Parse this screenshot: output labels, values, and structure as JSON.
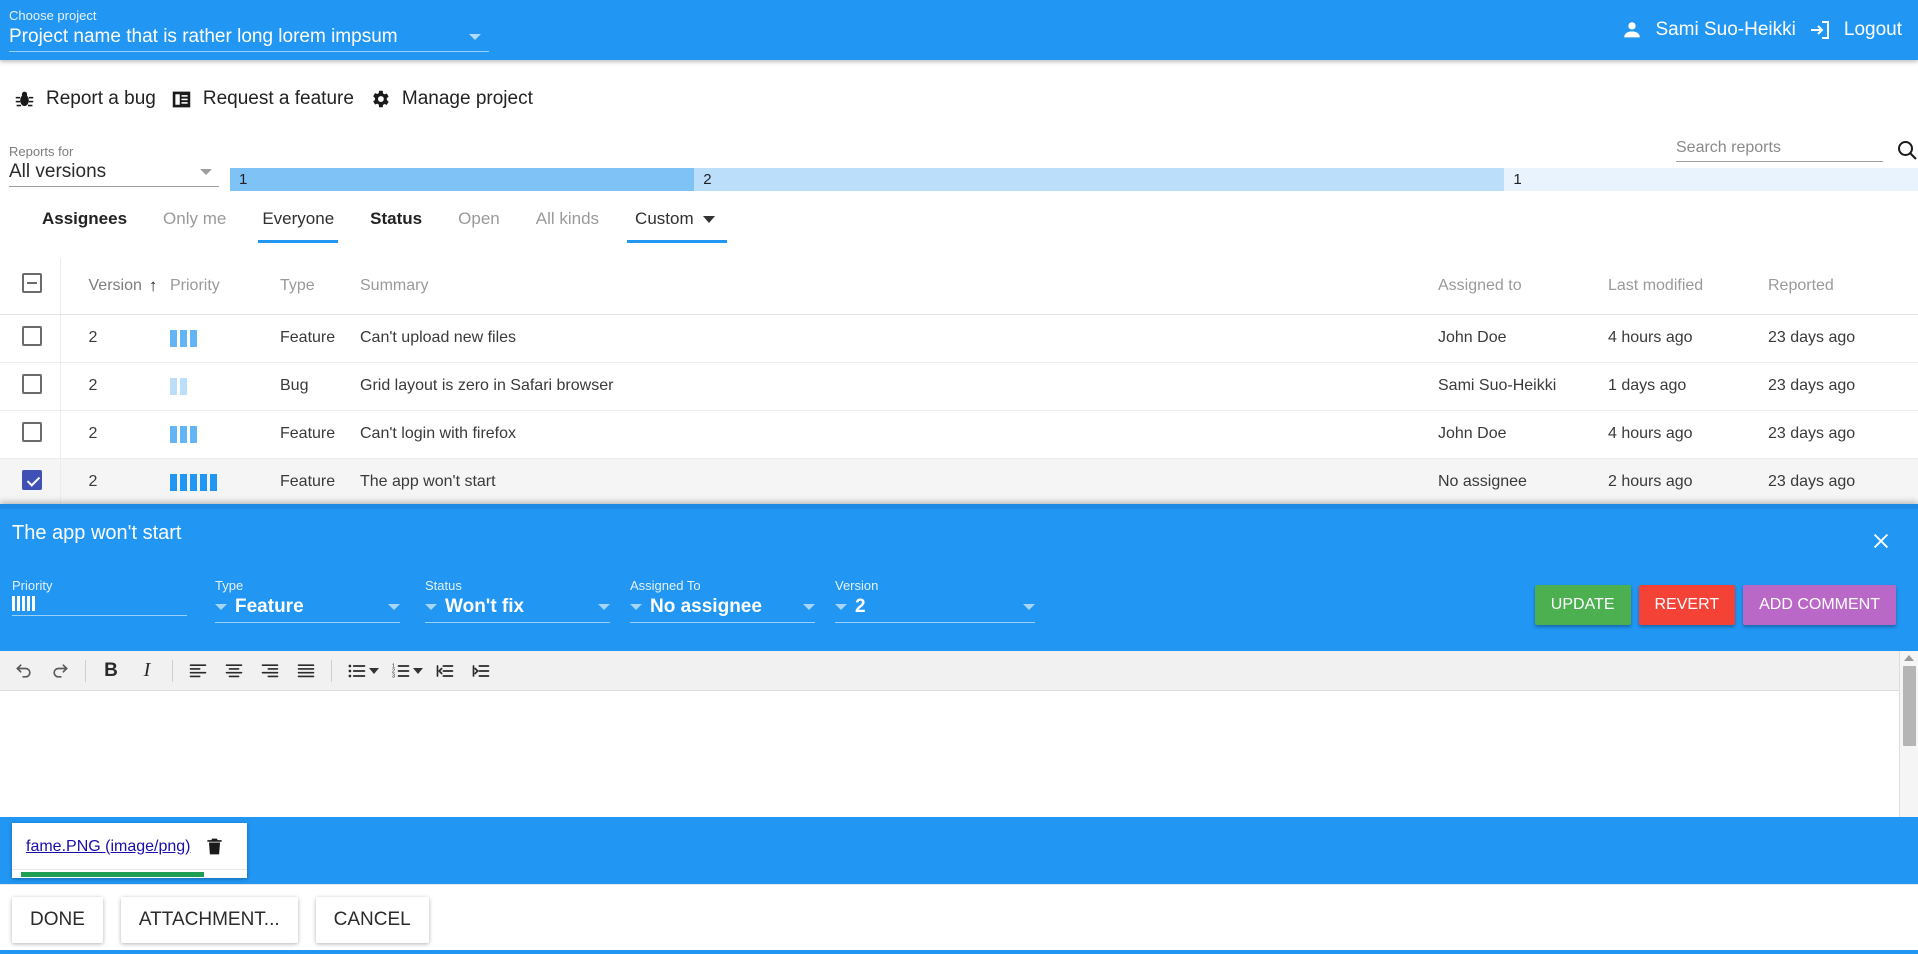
{
  "topbar": {
    "project_label": "Choose project",
    "project_value": "Project name that is rather long lorem impsum",
    "user_name": "Sami Suo-Heikki",
    "logout_label": "Logout"
  },
  "actions": [
    {
      "icon": "bug-icon",
      "label": "Report a bug"
    },
    {
      "icon": "feature-icon",
      "label": "Request a feature"
    },
    {
      "icon": "gear-icon",
      "label": "Manage project"
    }
  ],
  "search": {
    "placeholder": "Search reports",
    "value": "",
    "icon": "search-icon"
  },
  "version_filter": {
    "label": "Reports for",
    "value": "All versions",
    "segments": [
      {
        "label": "1",
        "width_pct": 27.5,
        "color": "#7fc2f5"
      },
      {
        "label": "2",
        "width_pct": 48.0,
        "color": "#bbdefb"
      },
      {
        "label": "1",
        "width_pct": 24.5,
        "color": "#e8f3fd"
      }
    ]
  },
  "tabs": [
    {
      "name": "assignees-group",
      "label": "Assignees",
      "state": "group"
    },
    {
      "name": "only-me",
      "label": "Only me",
      "state": "inactive"
    },
    {
      "name": "everyone",
      "label": "Everyone",
      "state": "active"
    },
    {
      "name": "status-group",
      "label": "Status",
      "state": "group"
    },
    {
      "name": "open",
      "label": "Open",
      "state": "inactive"
    },
    {
      "name": "all-kinds",
      "label": "All kinds",
      "state": "inactive"
    },
    {
      "name": "custom",
      "label": "Custom",
      "state": "custom"
    }
  ],
  "table": {
    "select_all_state": "indeterminate",
    "columns": [
      "Version",
      "Priority",
      "Type",
      "Summary",
      "Assigned to",
      "Last modified",
      "Reported"
    ],
    "sort_column": "Version",
    "sort_direction": "asc",
    "rows": [
      {
        "checked": false,
        "version": "2",
        "priority": 3,
        "priority_color": "#64b5f6",
        "type": "Feature",
        "summary": "Can't upload new files",
        "assigned_to": "John Doe",
        "last_modified": "4 hours ago",
        "reported": "23 days ago"
      },
      {
        "checked": false,
        "version": "2",
        "priority": 2,
        "priority_color": "#bbdefb",
        "type": "Bug",
        "summary": "Grid layout is zero in Safari browser",
        "assigned_to": "Sami Suo-Heikki",
        "last_modified": "1 days ago",
        "reported": "23 days ago"
      },
      {
        "checked": false,
        "version": "2",
        "priority": 3,
        "priority_color": "#64b5f6",
        "type": "Feature",
        "summary": "Can't login with firefox",
        "assigned_to": "John Doe",
        "last_modified": "4 hours ago",
        "reported": "23 days ago"
      },
      {
        "checked": true,
        "version": "2",
        "priority": 5,
        "priority_color": "#2196F3",
        "type": "Feature",
        "summary": "The app won't start",
        "assigned_to": "No assignee",
        "last_modified": "2 hours ago",
        "reported": "23 days ago"
      }
    ]
  },
  "detail": {
    "title": "The app won't start",
    "close_icon": "close-icon",
    "fields": [
      {
        "label": "Priority",
        "value": "",
        "bars": 5
      },
      {
        "label": "Type",
        "value": "Feature"
      },
      {
        "label": "Status",
        "value": "Won't fix"
      },
      {
        "label": "Assigned To",
        "value": "No assignee"
      },
      {
        "label": "Version",
        "value": "2"
      }
    ],
    "buttons": [
      {
        "label": "UPDATE",
        "color": "#4caf50"
      },
      {
        "label": "REVERT",
        "color": "#f44336"
      },
      {
        "label": "ADD COMMENT",
        "color": "#ba68c8"
      }
    ]
  },
  "editor": {
    "content": "",
    "toolbar": [
      {
        "icon": "undo-icon"
      },
      {
        "icon": "redo-icon"
      },
      {
        "sep": true
      },
      {
        "icon": "bold-icon",
        "label": "B"
      },
      {
        "icon": "italic-icon",
        "label": "I"
      },
      {
        "sep": true
      },
      {
        "icon": "align-left-icon"
      },
      {
        "icon": "align-center-icon"
      },
      {
        "icon": "align-right-icon"
      },
      {
        "icon": "align-justify-icon"
      },
      {
        "sep": true
      },
      {
        "icon": "bullet-list-icon",
        "caret": true
      },
      {
        "icon": "numbered-list-icon",
        "caret": true
      },
      {
        "icon": "outdent-icon"
      },
      {
        "icon": "indent-icon"
      }
    ]
  },
  "attachment": {
    "file_label": "fame.PNG (image/png)",
    "delete_icon": "trash-icon",
    "progress_pct": 78,
    "progress_color": "#1e9e52"
  },
  "footer_buttons": [
    {
      "name": "done-button",
      "label": "DONE"
    },
    {
      "name": "attachment-button",
      "label": "ATTACHMENT..."
    },
    {
      "name": "cancel-button",
      "label": "CANCEL"
    }
  ],
  "colors": {
    "accent": "#2196F3",
    "selected_checkbox": "#3f51b5"
  }
}
